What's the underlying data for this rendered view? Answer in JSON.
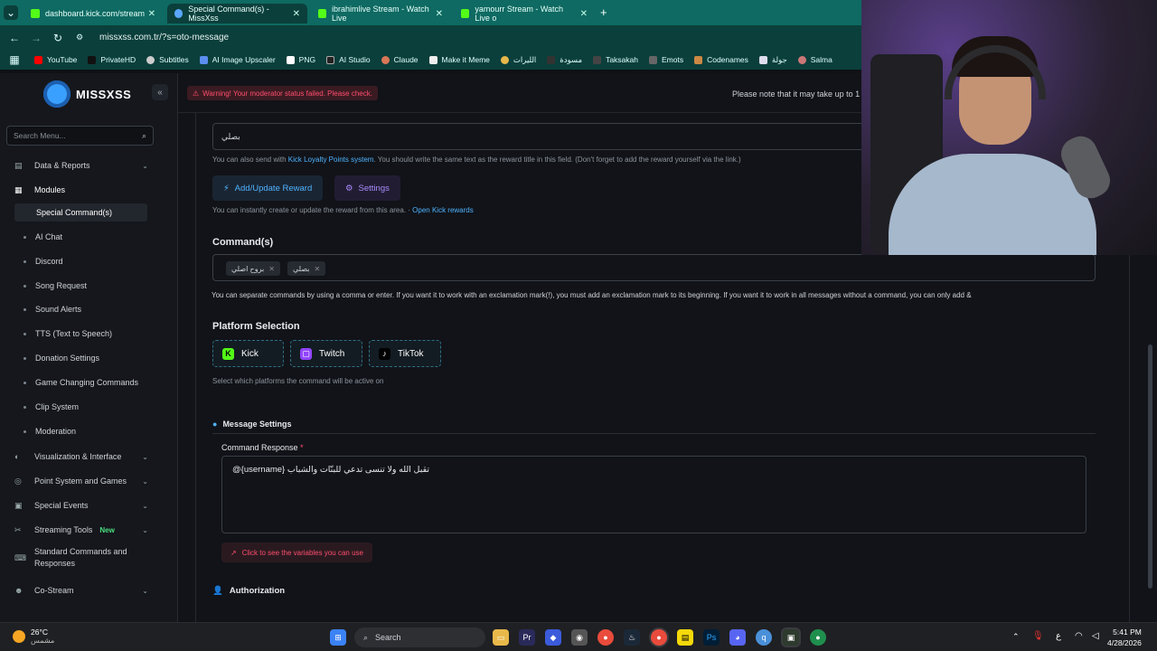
{
  "browser": {
    "tabs": [
      {
        "label": "dashboard.kick.com/stream"
      },
      {
        "label": "Special Command(s) - MissXss"
      },
      {
        "label": "ibrahimlive Stream - Watch Live"
      },
      {
        "label": "yamourr Stream - Watch Live o"
      }
    ],
    "url": "missxss.com.tr/?s=oto-message",
    "bookmarks": [
      "YouTube",
      "PrivateHD",
      "Subtitles",
      "AI Image Upscaler",
      "PNG",
      "AI Studio",
      "Claude",
      "Make it Meme",
      "الليرات",
      "مسودة",
      "Taksakah",
      "Emots",
      "Codenames",
      "جولة",
      "Salma"
    ]
  },
  "app": {
    "logo_text": "MISSXSS",
    "warning": "Warning! Your moderator status failed. Please check.",
    "top_note": "Please note that it may take up to 1",
    "search_placeholder": "Search Menu...",
    "nav": {
      "data_reports": "Data & Reports",
      "modules": "Modules",
      "special_commands": "Special Command(s)",
      "ai_chat": "AI Chat",
      "discord": "Discord",
      "song_request": "Song Request",
      "sound_alerts": "Sound Alerts",
      "tts": "TTS (Text to Speech)",
      "donation": "Donation Settings",
      "game_changing": "Game Changing Commands",
      "clip_system": "Clip System",
      "moderation": "Moderation",
      "visualization": "Visualization & Interface",
      "point_system": "Point System and Games",
      "special_events": "Special Events",
      "streaming_tools": "Streaming Tools",
      "new_badge": "New",
      "standard_commands_1": "Standard Commands and",
      "standard_commands_2": "Responses",
      "co_stream": "Co-Stream"
    }
  },
  "form": {
    "command_name_value": "بصلي",
    "loyalty_note_prefix": "You can also send with ",
    "loyalty_link": "Kick Loyalty Points system",
    "loyalty_note_suffix": ". You should write the same text as the reward title in this field. (Don't forget to add the reward yourself via the link.)",
    "add_reward_button": "Add/Update Reward",
    "settings_button": "Settings",
    "reward_note": "You can instantly create or update the reward from this area. · ",
    "open_rewards_link": "Open Kick rewards",
    "commands_heading": "Command(s)",
    "commands": [
      "بروح اصلي",
      "بصلي"
    ],
    "commands_note": "You can separate commands by using a comma or enter. If you want it to work with an exclamation mark(!), you must add an exclamation mark to its beginning. If you want it to work in all messages without a command, you can only add &",
    "platform_heading": "Platform Selection",
    "platforms": [
      "Kick",
      "Twitch",
      "TikTok"
    ],
    "platform_note": "Select which platforms the command will be active on",
    "message_settings_heading": "Message Settings",
    "command_response_label": "Command Response",
    "required_mark": "*",
    "command_response_value": "@{username} تقبل الله ولا تنسى تدعي للبنّات والشباب",
    "variables_button": "Click to see the variables you can use",
    "authorization_heading": "Authorization"
  },
  "taskbar": {
    "temperature": "26°C",
    "weather_text": "مشمس",
    "search_label": "Search",
    "time": "5:41 PM",
    "date": "4/28/2026",
    "lang": "ع"
  },
  "colors": {
    "accent": "#4fb3ff",
    "warning": "#ff4d6d",
    "kick_green": "#53fc18",
    "twitch_purple": "#9146ff"
  }
}
